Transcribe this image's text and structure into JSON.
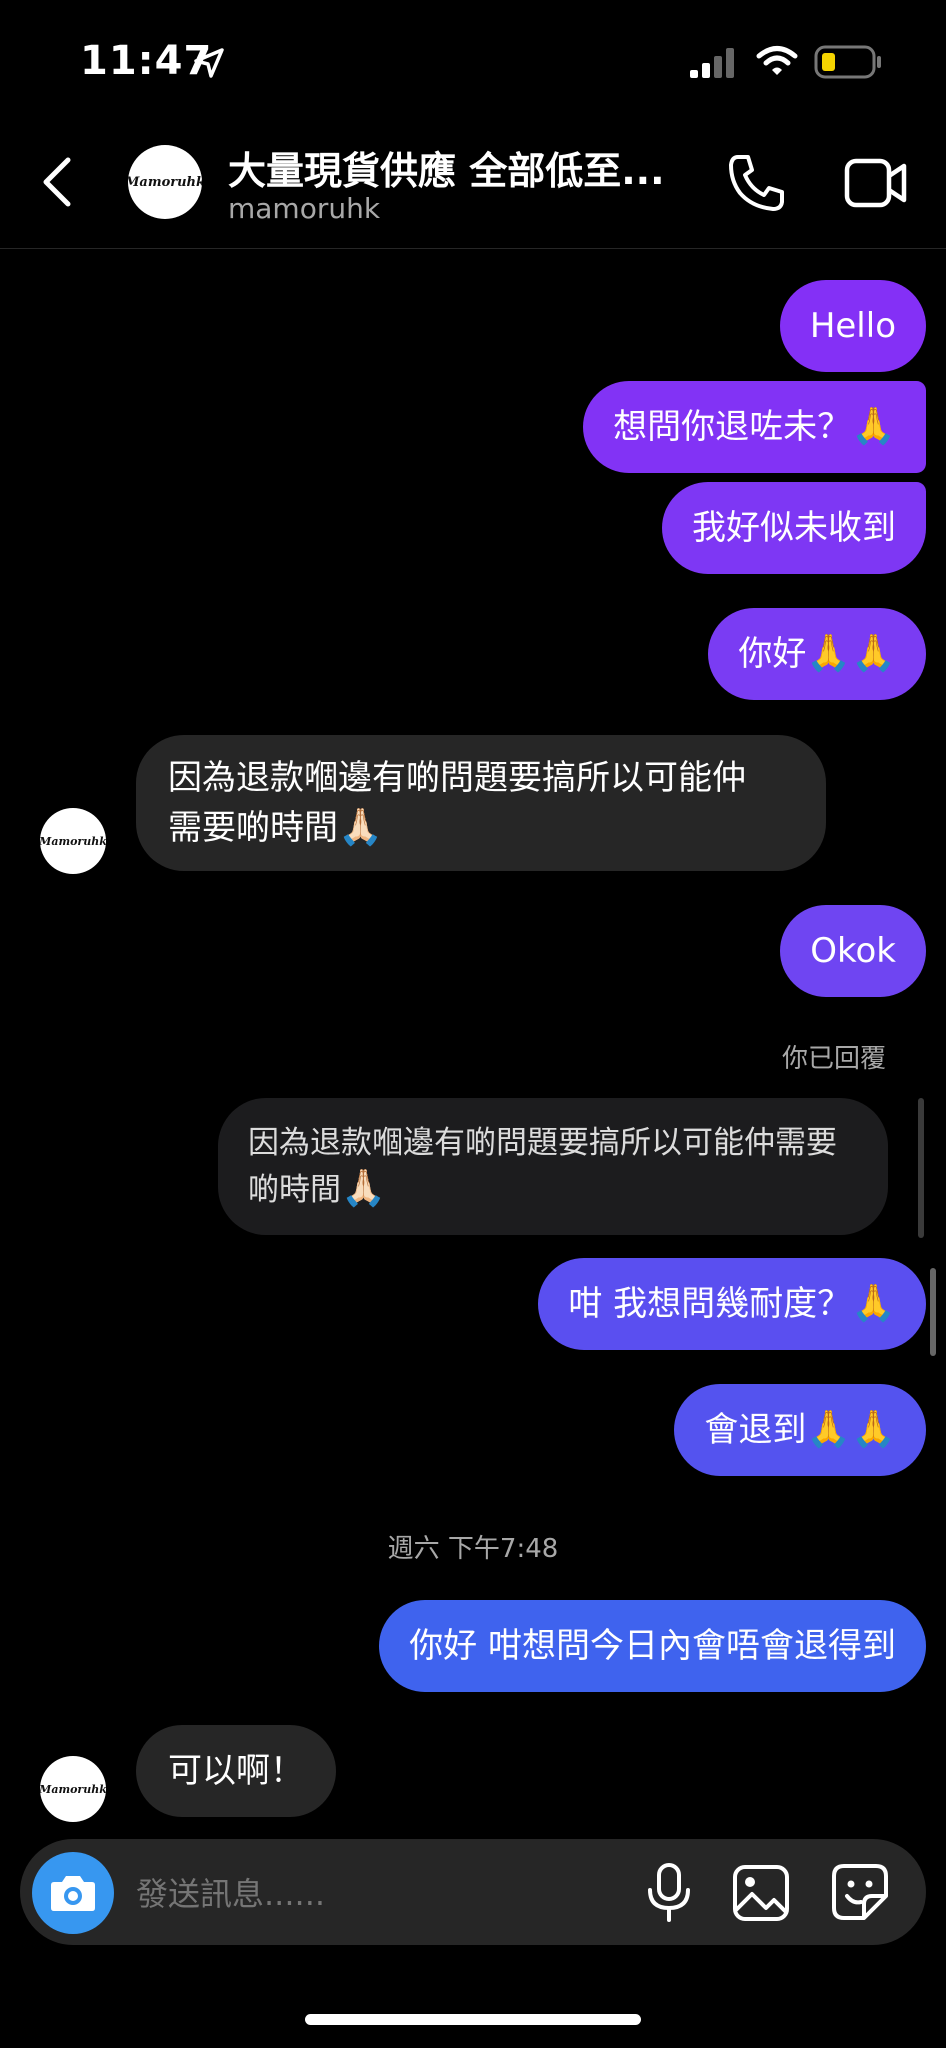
{
  "status_bar": {
    "time": "11:47",
    "battery_color": "#f5d400"
  },
  "header": {
    "title": "大量現貨供應 全部低至...",
    "username": "mamoruhk",
    "avatar_text": "Mamoruhk"
  },
  "messages": [
    {
      "text": "Hello"
    },
    {
      "text": "想問你退咗未？",
      "emoji": "🙏"
    },
    {
      "text": "我好似未收到"
    },
    {
      "text": "你好",
      "emoji": "🙏🙏"
    },
    {
      "line1": "因為退款嗰邊有啲問題要搞所以可能仲",
      "line2": "需要啲時間",
      "emoji": "🙏🏻"
    },
    {
      "text": "Okok"
    },
    {
      "reply_label": "你已回覆",
      "line1": "因為退款嗰邊有啲問題要搞所以可能仲需要",
      "line2": "啲時間",
      "emoji": "🙏🏻"
    },
    {
      "text": "咁 我想問幾耐度？",
      "emoji": "🙏"
    },
    {
      "text": "會退到",
      "emoji": "🙏🙏"
    },
    {
      "timestamp": "週六 下午7:48"
    },
    {
      "text": "你好 咁想問今日內會唔會退得到"
    },
    {
      "text": "可以啊！"
    }
  ],
  "composer": {
    "placeholder": "發送訊息......"
  },
  "colors": {
    "bubble_purple": "#8430f6",
    "bubble_indigo": "#4f55ef",
    "bubble_blue": "#3f63ee",
    "incoming": "#262626"
  },
  "icons": [
    "location-arrow-icon",
    "signal-icon",
    "wifi-icon",
    "battery-icon",
    "back-chevron-icon",
    "phone-icon",
    "video-icon",
    "camera-icon",
    "microphone-icon",
    "gallery-icon",
    "sticker-icon"
  ]
}
